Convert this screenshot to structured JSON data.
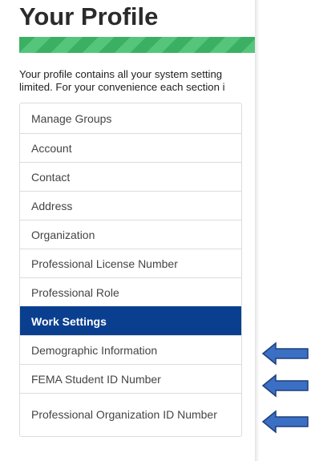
{
  "page": {
    "title": "Your Profile",
    "intro_line1": "Your profile contains all your system setting",
    "intro_line2": "limited. For your convenience each section i"
  },
  "progress": {
    "percent": 100,
    "color": "#3bb062"
  },
  "menu": {
    "active_color": "#0a3f8f",
    "items": [
      {
        "label": "Manage Groups"
      },
      {
        "label": "Account"
      },
      {
        "label": "Contact"
      },
      {
        "label": "Address"
      },
      {
        "label": "Organization"
      },
      {
        "label": "Professional License Number"
      },
      {
        "label": "Professional Role"
      },
      {
        "label": "Work Settings"
      },
      {
        "label": "Demographic Information"
      },
      {
        "label": "FEMA Student ID Number"
      },
      {
        "label": "Professional Organization ID Number"
      }
    ]
  },
  "annotations": {
    "arrow_icon": "left-arrow-icon",
    "arrow_color": "#3a6fc4"
  }
}
